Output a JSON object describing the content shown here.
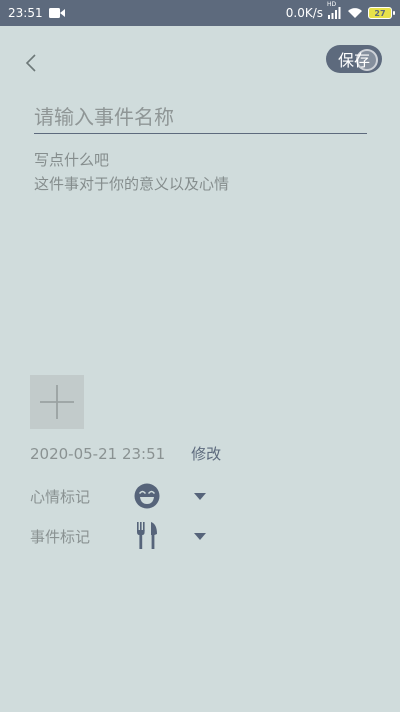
{
  "status_bar": {
    "time": "23:51",
    "net_speed": "0.0K/s",
    "signal_label": "HD",
    "battery": "27",
    "icons": [
      "video-icon",
      "signal-icon",
      "wifi-icon",
      "battery-icon"
    ]
  },
  "header": {
    "back_icon": "chevron-left-icon",
    "save_label": "保存"
  },
  "form": {
    "title_placeholder": "请输入事件名称",
    "desc_placeholder_line1": "写点什么吧",
    "desc_placeholder_line2": "这件事对于你的意义以及心情"
  },
  "photo": {
    "add_icon": "plus-icon"
  },
  "date": {
    "value": "2020-05-21 23:51",
    "edit_label": "修改"
  },
  "marks": {
    "mood_label": "心情标记",
    "mood_icon": "laughing-face-icon",
    "event_label": "事件标记",
    "event_icon": "fork-knife-icon"
  },
  "colors": {
    "background": "#d0dcdc",
    "accent": "#5d6a7d",
    "status_bar": "#5d6a7d",
    "battery": "#e8e14a"
  }
}
